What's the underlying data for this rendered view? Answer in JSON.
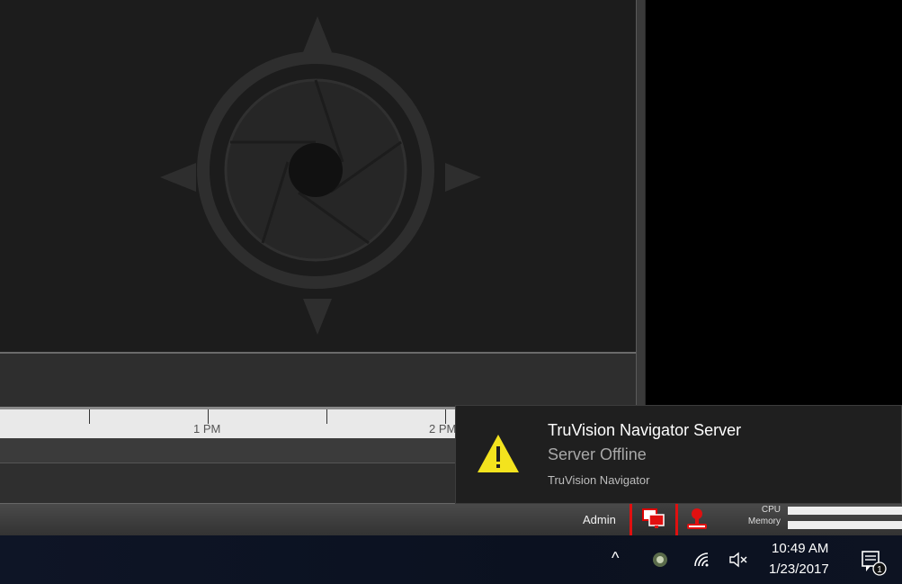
{
  "timeline": {
    "labels": [
      "1 PM",
      "2 PM"
    ]
  },
  "status_bar": {
    "user": "Admin",
    "cpu_label": "CPU",
    "memory_label": "Memory"
  },
  "notification": {
    "title": "TruVision Navigator Server",
    "message": "Server Offline",
    "source": "TruVision Navigator",
    "icon": "warning-icon"
  },
  "taskbar": {
    "time": "10:49 AM",
    "date": "1/23/2017",
    "notification_count": "1"
  },
  "colors": {
    "warning_yellow": "#f3e31e",
    "alert_red": "#e01010"
  }
}
